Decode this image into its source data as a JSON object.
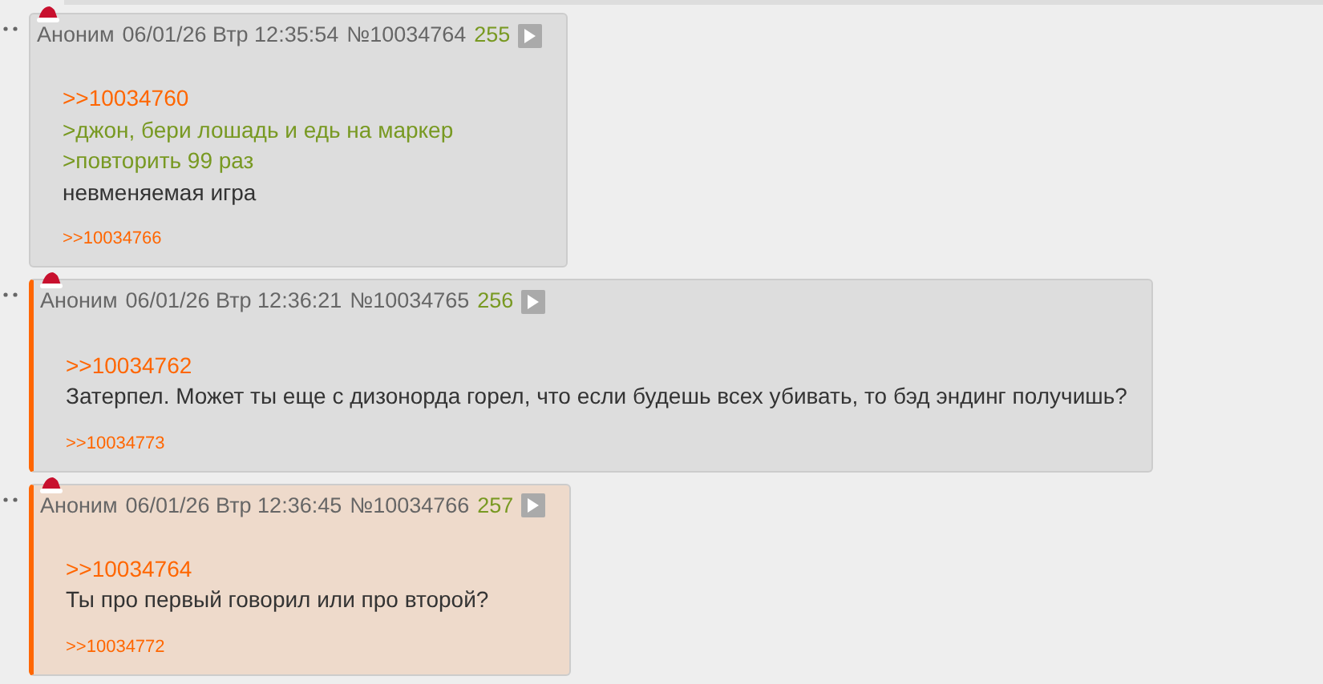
{
  "posts": [
    {
      "name": "Аноним",
      "date": "06/01/26 Втр 12:35:54",
      "number": "№10034764",
      "ordinal": "255",
      "highlighted": false,
      "marked": false,
      "lines": [
        {
          "kind": "reply",
          "text": ">>10034760"
        },
        {
          "kind": "quote",
          "text": ">джон, бери лошадь и едь на маркер"
        },
        {
          "kind": "quote",
          "text": ">повторить 99 раз"
        },
        {
          "kind": "plain",
          "text": "невменяемая игра"
        }
      ],
      "replies": [
        ">>10034766"
      ]
    },
    {
      "name": "Аноним",
      "date": "06/01/26 Втр 12:36:21",
      "number": "№10034765",
      "ordinal": "256",
      "highlighted": false,
      "marked": true,
      "lines": [
        {
          "kind": "reply",
          "text": ">>10034762"
        },
        {
          "kind": "plain",
          "text": "Затерпел. Может ты еще с дизонорда горел, что если будешь всех убивать, то бэд эндинг получишь?"
        }
      ],
      "replies": [
        ">>10034773"
      ]
    },
    {
      "name": "Аноним",
      "date": "06/01/26 Втр 12:36:45",
      "number": "№10034766",
      "ordinal": "257",
      "highlighted": true,
      "marked": true,
      "lines": [
        {
          "kind": "reply",
          "text": ">>10034764"
        },
        {
          "kind": "plain",
          "text": "Ты про первый говорил или про второй?"
        }
      ],
      "replies": [
        ">>10034772"
      ]
    }
  ]
}
